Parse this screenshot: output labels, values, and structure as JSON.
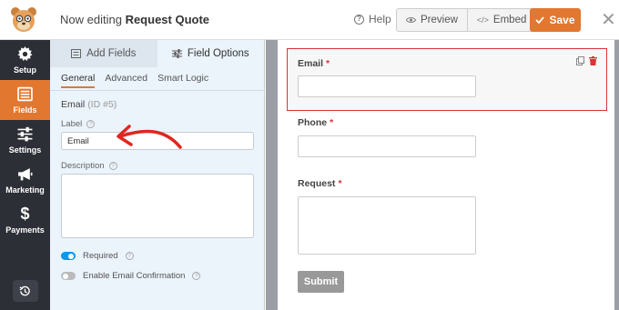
{
  "header": {
    "editing_prefix": "Now editing",
    "form_name": "Request Quote",
    "help_label": "Help",
    "preview_label": "Preview",
    "embed_label": "Embed",
    "save_label": "Save"
  },
  "nav": {
    "items": [
      {
        "label": "Setup",
        "icon": "gear-icon"
      },
      {
        "label": "Fields",
        "icon": "fields-icon"
      },
      {
        "label": "Settings",
        "icon": "sliders-icon"
      },
      {
        "label": "Marketing",
        "icon": "megaphone-icon"
      },
      {
        "label": "Payments",
        "icon": "dollar-icon"
      }
    ]
  },
  "panel": {
    "tabs": [
      {
        "label": "Add Fields"
      },
      {
        "label": "Field Options"
      }
    ],
    "subtabs": [
      {
        "label": "General"
      },
      {
        "label": "Advanced"
      },
      {
        "label": "Smart Logic"
      }
    ],
    "field_name": "Email",
    "field_id": "(ID #5)",
    "label_caption": "Label",
    "label_value": "Email",
    "description_caption": "Description",
    "description_value": "",
    "required_label": "Required",
    "confirmation_label": "Enable Email Confirmation",
    "required_on": true,
    "confirmation_on": false
  },
  "form": {
    "fields": [
      {
        "label": "Email",
        "required_mark": "*"
      },
      {
        "label": "Phone",
        "required_mark": "*"
      },
      {
        "label": "Request",
        "required_mark": "*"
      }
    ],
    "submit_label": "Submit"
  },
  "colors": {
    "accent": "#e27730",
    "nav_bg": "#2d2f36",
    "toggle_on": "#0399ed",
    "selected_border": "#d63638"
  }
}
